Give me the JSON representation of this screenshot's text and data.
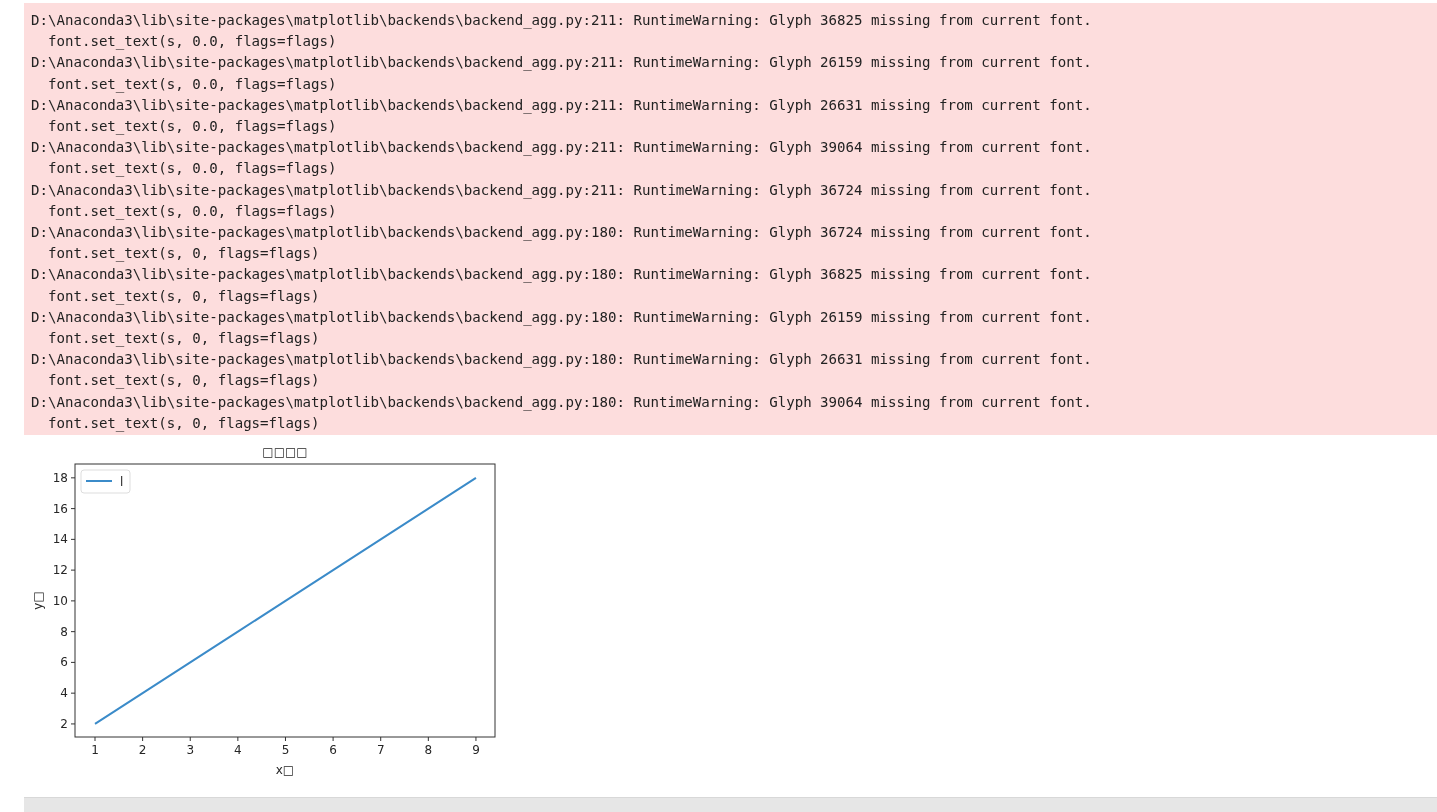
{
  "stderr_output": [
    {
      "location": "D:\\Anaconda3\\lib\\site-packages\\matplotlib\\backends\\backend_agg.py:211: RuntimeWarning: Glyph 36825 missing from current font.",
      "code": "  font.set_text(s, 0.0, flags=flags)"
    },
    {
      "location": "D:\\Anaconda3\\lib\\site-packages\\matplotlib\\backends\\backend_agg.py:211: RuntimeWarning: Glyph 26159 missing from current font.",
      "code": "  font.set_text(s, 0.0, flags=flags)"
    },
    {
      "location": "D:\\Anaconda3\\lib\\site-packages\\matplotlib\\backends\\backend_agg.py:211: RuntimeWarning: Glyph 26631 missing from current font.",
      "code": "  font.set_text(s, 0.0, flags=flags)"
    },
    {
      "location": "D:\\Anaconda3\\lib\\site-packages\\matplotlib\\backends\\backend_agg.py:211: RuntimeWarning: Glyph 39064 missing from current font.",
      "code": "  font.set_text(s, 0.0, flags=flags)"
    },
    {
      "location": "D:\\Anaconda3\\lib\\site-packages\\matplotlib\\backends\\backend_agg.py:211: RuntimeWarning: Glyph 36724 missing from current font.",
      "code": "  font.set_text(s, 0.0, flags=flags)"
    },
    {
      "location": "D:\\Anaconda3\\lib\\site-packages\\matplotlib\\backends\\backend_agg.py:180: RuntimeWarning: Glyph 36724 missing from current font.",
      "code": "  font.set_text(s, 0, flags=flags)"
    },
    {
      "location": "D:\\Anaconda3\\lib\\site-packages\\matplotlib\\backends\\backend_agg.py:180: RuntimeWarning: Glyph 36825 missing from current font.",
      "code": "  font.set_text(s, 0, flags=flags)"
    },
    {
      "location": "D:\\Anaconda3\\lib\\site-packages\\matplotlib\\backends\\backend_agg.py:180: RuntimeWarning: Glyph 26159 missing from current font.",
      "code": "  font.set_text(s, 0, flags=flags)"
    },
    {
      "location": "D:\\Anaconda3\\lib\\site-packages\\matplotlib\\backends\\backend_agg.py:180: RuntimeWarning: Glyph 26631 missing from current font.",
      "code": "  font.set_text(s, 0, flags=flags)"
    },
    {
      "location": "D:\\Anaconda3\\lib\\site-packages\\matplotlib\\backends\\backend_agg.py:180: RuntimeWarning: Glyph 39064 missing from current font.",
      "code": "  font.set_text(s, 0, flags=flags)"
    }
  ],
  "plot": {
    "chart_data": {
      "type": "line",
      "title": "□□□□",
      "xlabel": "x□",
      "ylabel": "y□",
      "x": [
        1,
        2,
        3,
        4,
        5,
        6,
        7,
        8,
        9
      ],
      "series": [
        {
          "name": "l",
          "color": "#3b8bc9",
          "values": [
            2,
            4,
            6,
            8,
            10,
            12,
            14,
            16,
            18
          ]
        }
      ],
      "xlim": [
        0.58,
        9.4
      ],
      "ylim": [
        1.15,
        18.9
      ],
      "xticks": [
        1,
        2,
        3,
        4,
        5,
        6,
        7,
        8,
        9
      ],
      "yticks": [
        2,
        4,
        6,
        8,
        10,
        12,
        14,
        16,
        18
      ]
    }
  }
}
